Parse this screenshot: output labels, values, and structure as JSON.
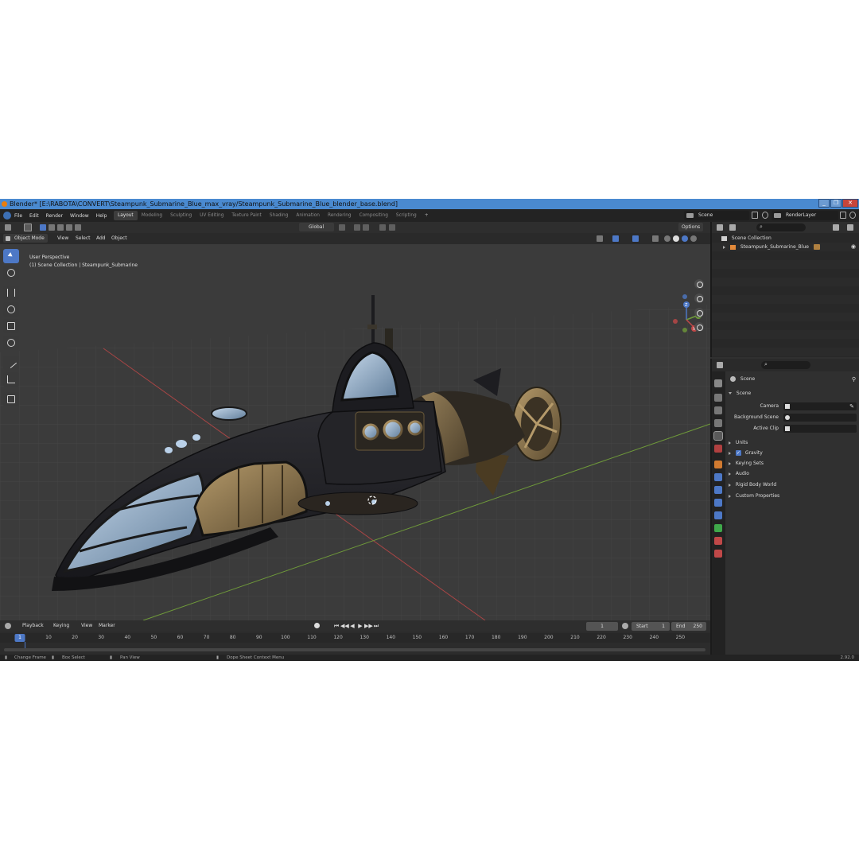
{
  "window": {
    "title": "Blender* [E:\\RABOTA\\CONVERT\\Steampunk_Submarine_Blue_max_vray/Steampunk_Submarine_Blue_blender_base.blend]",
    "controls": [
      "_",
      "❐",
      "✕"
    ]
  },
  "menu": [
    "File",
    "Edit",
    "Render",
    "Window",
    "Help"
  ],
  "workspaces": {
    "tabs": [
      "Layout",
      "Modeling",
      "Sculpting",
      "UV Editing",
      "Texture Paint",
      "Shading",
      "Animation",
      "Rendering",
      "Compositing",
      "Scripting"
    ],
    "active": "Layout",
    "add": "+"
  },
  "scene_selector": {
    "value": "Scene"
  },
  "view_layer_selector": {
    "value": "RenderLayer"
  },
  "viewport_header": {
    "mode": "Object Mode",
    "menus": [
      "View",
      "Select",
      "Add",
      "Object"
    ],
    "orientation": "Global",
    "options": "Options"
  },
  "viewport": {
    "perspective": "User Perspective",
    "collection_info": "(1) Scene Collection | Steampunk_Submarine"
  },
  "gizmo": {
    "x": "X",
    "y": "Y",
    "z": "Z"
  },
  "timeline": {
    "menus": [
      "Playback",
      "Keying",
      "View",
      "Marker"
    ],
    "current_frame": "1",
    "start_label": "Start",
    "start": "1",
    "end_label": "End",
    "end": "250",
    "ruler": [
      "10",
      "20",
      "30",
      "40",
      "50",
      "60",
      "70",
      "80",
      "90",
      "100",
      "110",
      "120",
      "130",
      "140",
      "150",
      "160",
      "170",
      "180",
      "190",
      "200",
      "210",
      "220",
      "230",
      "240",
      "250"
    ],
    "playhead": "1"
  },
  "statusbar": {
    "items": [
      "Change Frame",
      "Box Select",
      "Pan View",
      "Dope Sheet Context Menu"
    ],
    "version": "2.92.0"
  },
  "outliner": {
    "root": "Scene Collection",
    "items": [
      "Steampunk_Submarine_Blue"
    ]
  },
  "properties": {
    "header": "Scene",
    "panel": "Scene",
    "fields": [
      {
        "label": "Camera"
      },
      {
        "label": "Background Scene"
      },
      {
        "label": "Active Clip"
      }
    ],
    "sections": [
      "Units",
      "Gravity",
      "Keying Sets",
      "Audio",
      "Rigid Body World",
      "Custom Properties"
    ],
    "gravity_checked": true
  },
  "colors": {
    "accent": "#4d78c6",
    "viewport_bg": "#3b3b3b",
    "panel_bg": "#303030",
    "titlebar": "#4a8ad0"
  }
}
